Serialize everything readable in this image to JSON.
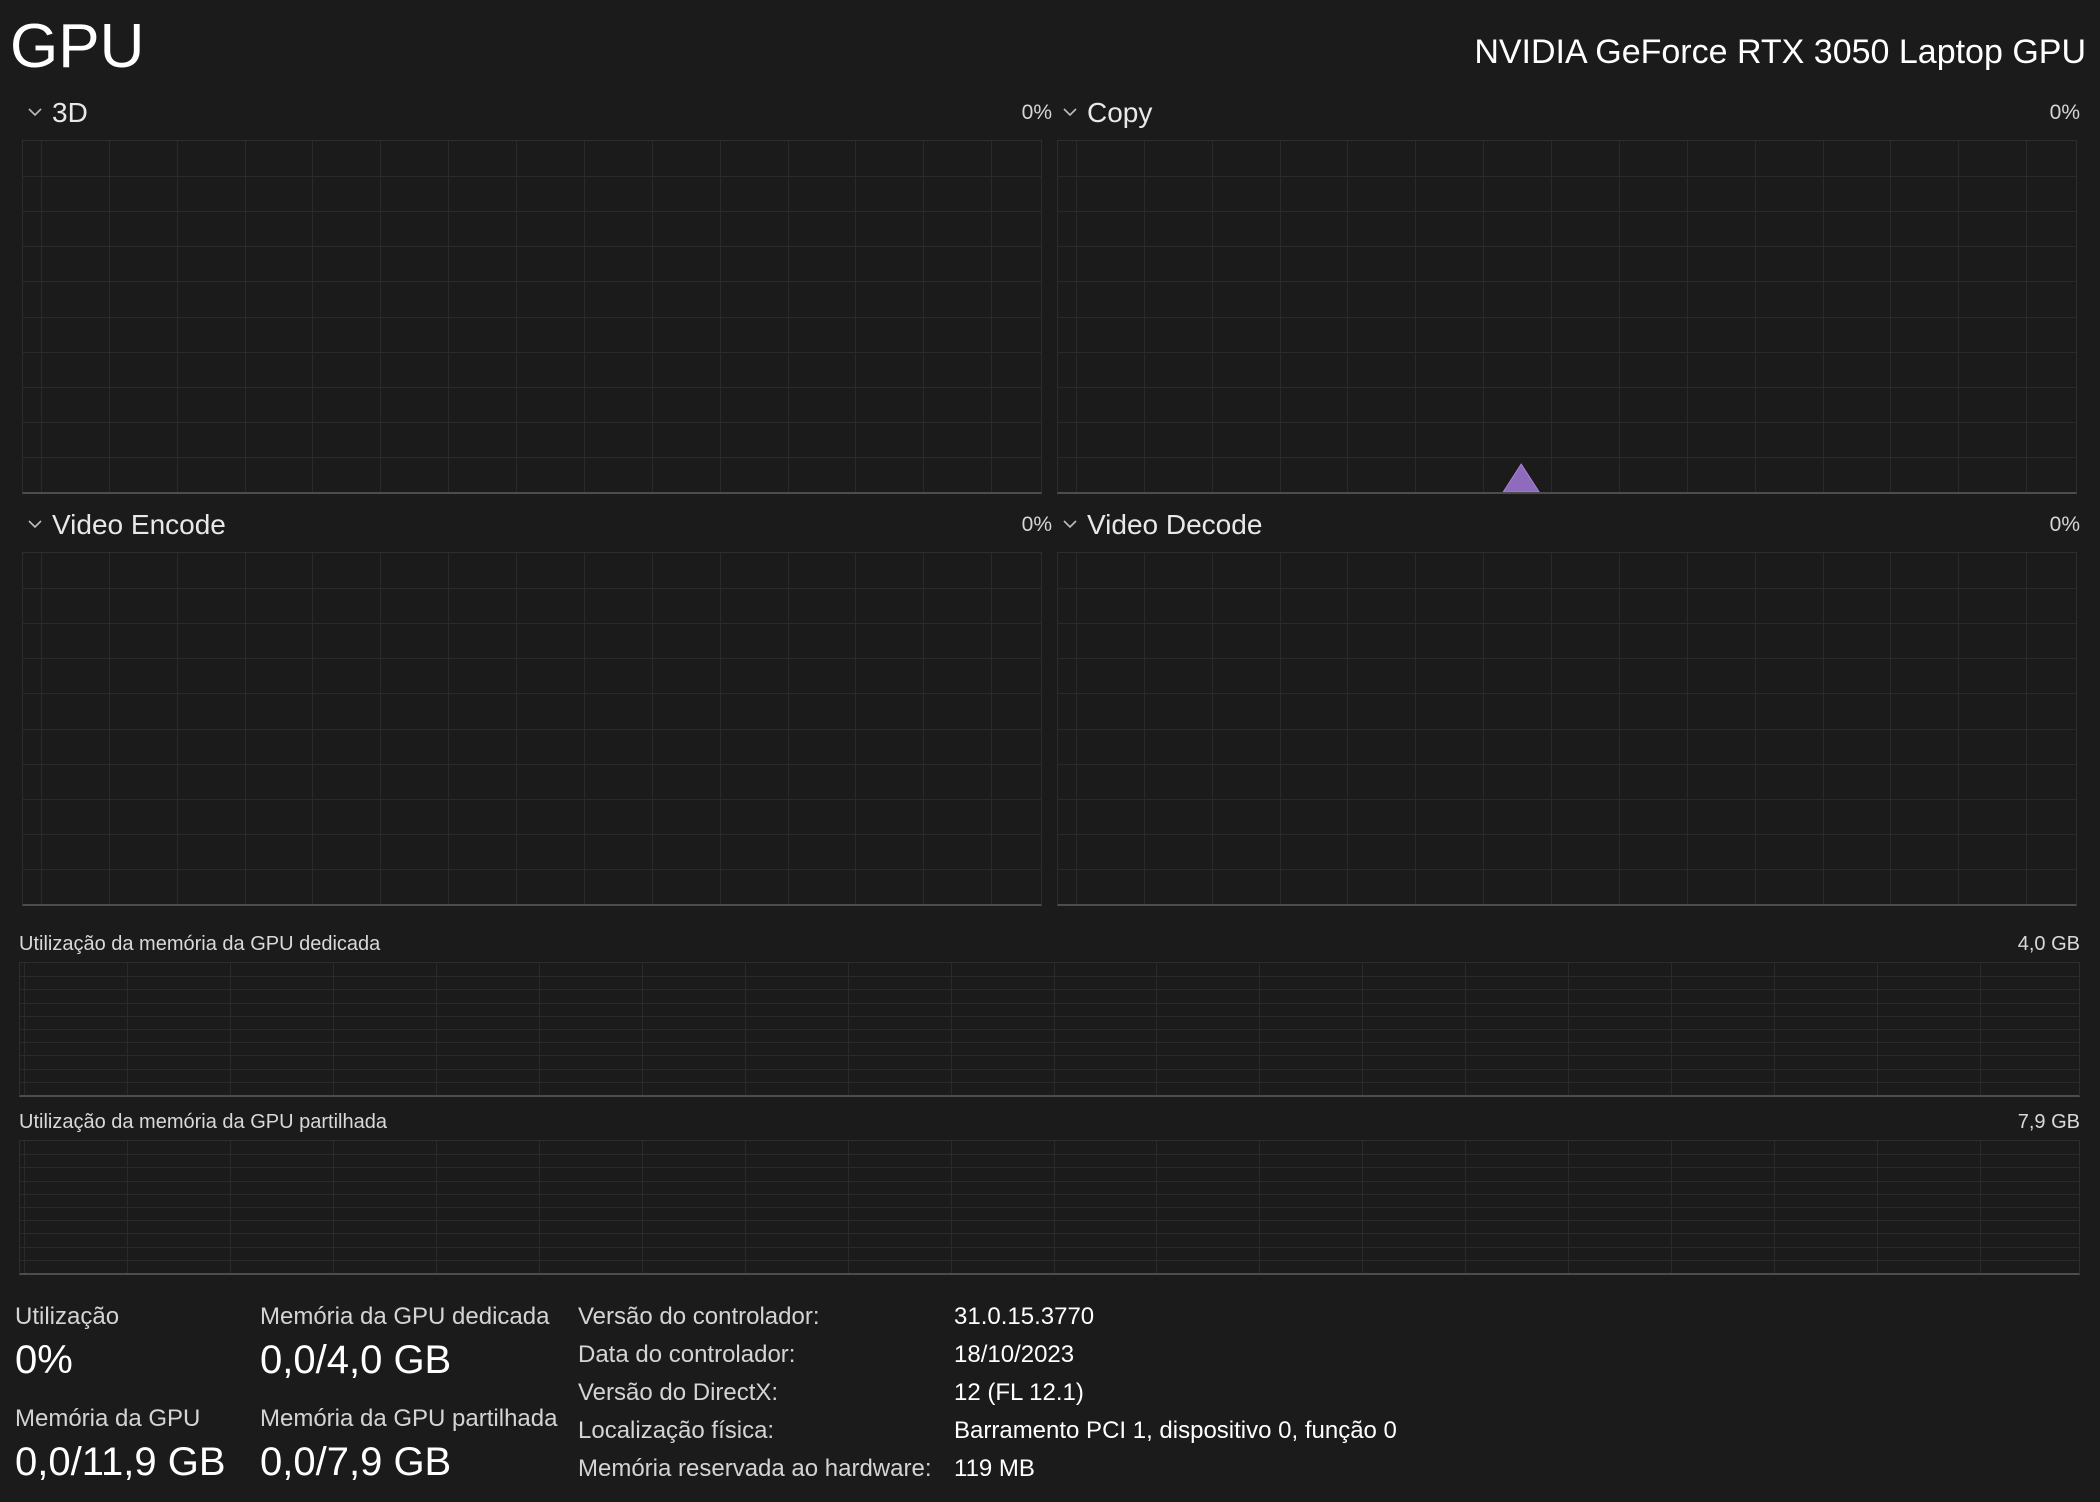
{
  "header": {
    "title": "GPU",
    "device_name": "NVIDIA GeForce RTX 3050 Laptop GPU"
  },
  "engines": [
    {
      "name": "3D",
      "percent": "0%"
    },
    {
      "name": "Copy",
      "percent": "0%"
    },
    {
      "name": "Video Encode",
      "percent": "0%"
    },
    {
      "name": "Video Decode",
      "percent": "0%"
    }
  ],
  "memory_graphs": {
    "dedicated": {
      "label": "Utilização da memória da GPU dedicada",
      "max": "4,0 GB"
    },
    "shared": {
      "label": "Utilização da memória da GPU partilhada",
      "max": "7,9 GB"
    }
  },
  "stats": {
    "utilization": {
      "label": "Utilização",
      "value": "0%"
    },
    "dedicated_memory": {
      "label": "Memória da GPU dedicada",
      "value": "0,0/4,0 GB"
    },
    "gpu_memory": {
      "label": "Memória da GPU",
      "value": "0,0/11,9 GB"
    },
    "shared_memory": {
      "label": "Memória da GPU partilhada",
      "value": "0,0/7,9 GB"
    }
  },
  "info": {
    "driver_version": {
      "label": "Versão do controlador:",
      "value": "31.0.15.3770"
    },
    "driver_date": {
      "label": "Data do controlador:",
      "value": "18/10/2023"
    },
    "directx_version": {
      "label": "Versão do DirectX:",
      "value": "12 (FL 12.1)"
    },
    "physical_location": {
      "label": "Localização física:",
      "value": "Barramento PCI 1, dispositivo 0, função 0"
    },
    "hardware_reserved": {
      "label": "Memória reservada ao hardware:",
      "value": "119 MB"
    }
  },
  "colors": {
    "background": "#1b1b1b",
    "grid_line": "#2a2a2a",
    "graph_accent": "#8f6bbd"
  }
}
